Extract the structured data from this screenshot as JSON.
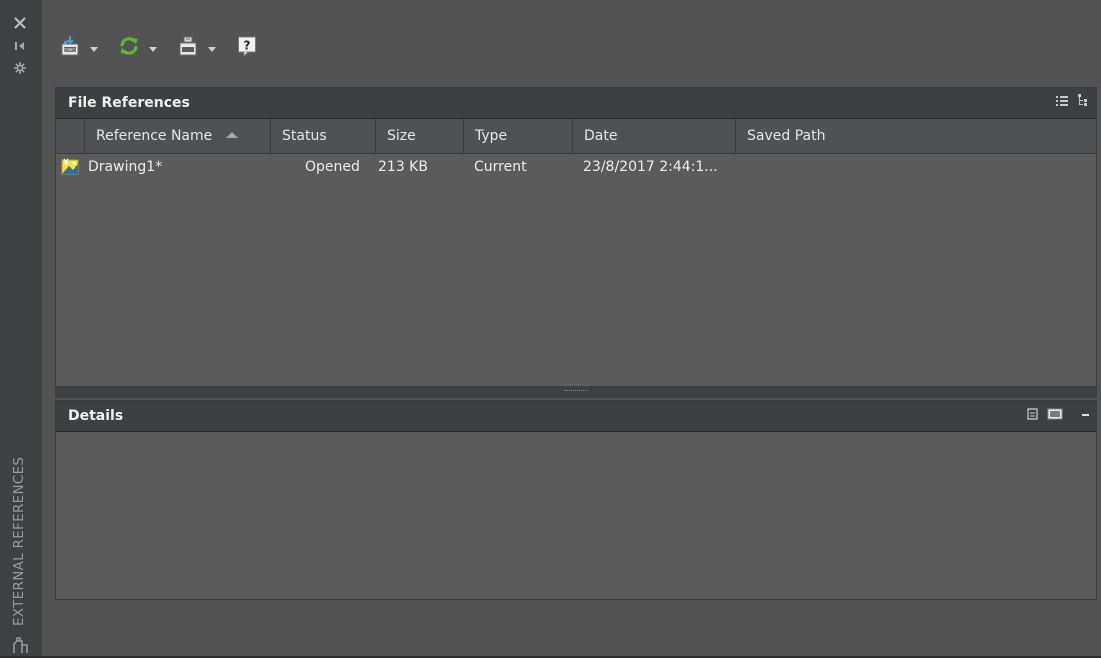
{
  "palette": {
    "vertical_title": "EXTERNAL REFERENCES",
    "strip_buttons": [
      "close-icon",
      "auto-hide-icon",
      "properties-icon"
    ]
  },
  "toolbar": {
    "buttons": [
      {
        "name": "attach-dwg",
        "icon": "attach-dwg-icon",
        "has_menu": true
      },
      {
        "name": "refresh",
        "icon": "refresh-icon",
        "has_menu": true
      },
      {
        "name": "change-path",
        "icon": "change-path-icon",
        "has_menu": true
      },
      {
        "name": "help",
        "icon": "help-icon",
        "has_menu": false
      }
    ]
  },
  "file_references": {
    "title": "File References",
    "columns": [
      "Reference Name",
      "Status",
      "Size",
      "Type",
      "Date",
      "Saved Path"
    ],
    "sorted_column": "Reference Name",
    "rows": [
      {
        "name": "Drawing1*",
        "status": "Opened",
        "size": "213 KB",
        "type": "Current",
        "date": "23/8/2017 2:44:1...",
        "saved_path": ""
      }
    ]
  },
  "details": {
    "title": "Details"
  },
  "colors": {
    "panel_bg": "#5b5b5b",
    "header_bg": "#3e3f42",
    "accent_green": "#5fb832"
  }
}
